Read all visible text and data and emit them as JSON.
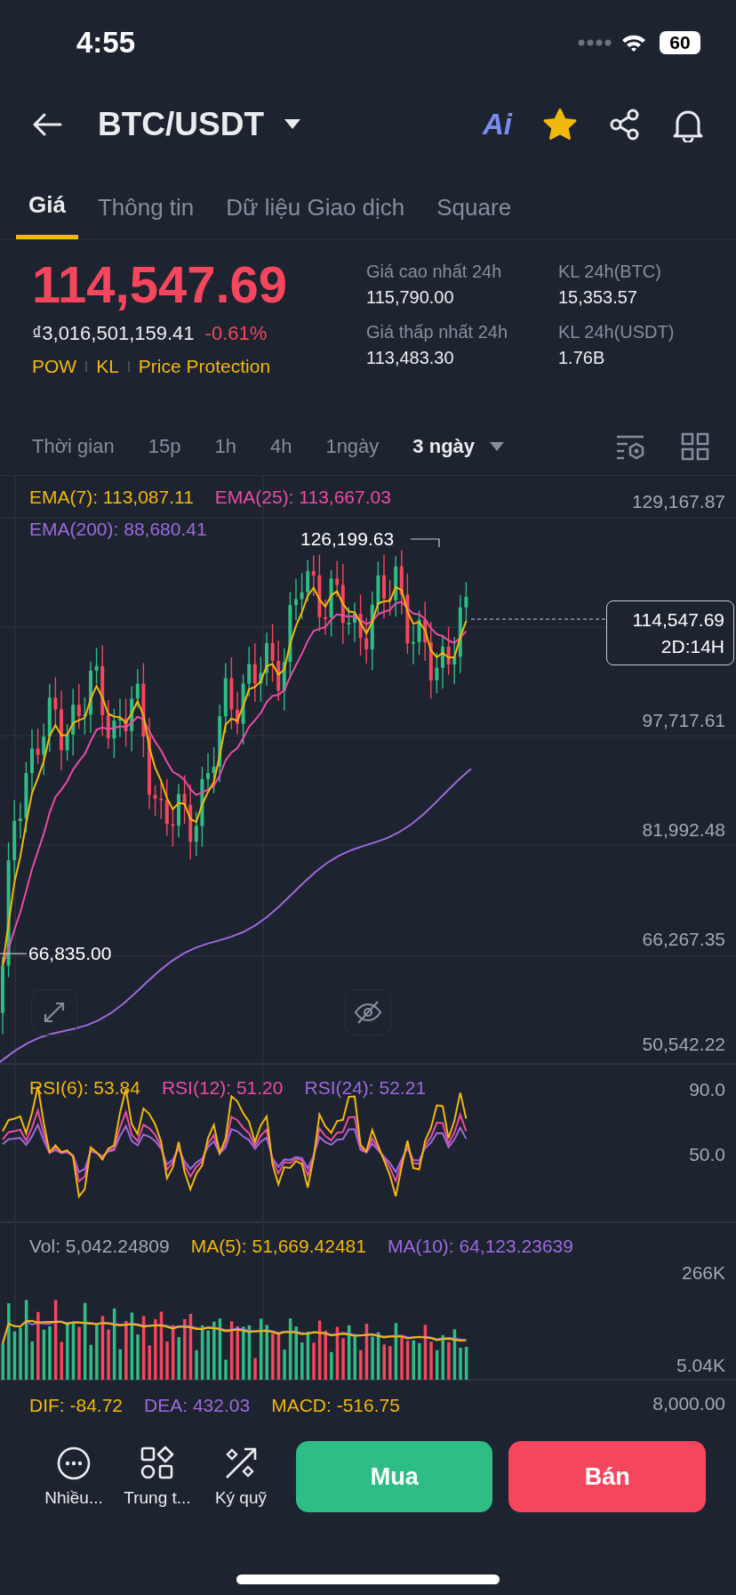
{
  "status_bar": {
    "time": "4:55",
    "battery": "60"
  },
  "header": {
    "pair": "BTC/USDT",
    "ai_label": "Ai",
    "favorite": true
  },
  "tabs": [
    {
      "label": "Giá",
      "selected": true
    },
    {
      "label": "Thông tin",
      "selected": false
    },
    {
      "label": "Dữ liệu Giao dịch",
      "selected": false
    },
    {
      "label": "Square",
      "selected": false
    }
  ],
  "ticker": {
    "price": "114,547.69",
    "fiat_price": "₫3,016,501,159.41",
    "change": "-0.61%",
    "tags": [
      "POW",
      "KL",
      "Price Protection"
    ],
    "stats": [
      {
        "label": "Giá cao nhất 24h",
        "value": "115,790.00"
      },
      {
        "label": "KL 24h(BTC)",
        "value": "15,353.57"
      },
      {
        "label": "Giá thấp nhất 24h",
        "value": "113,483.30"
      },
      {
        "label": "KL 24h(USDT)",
        "value": "1.76B"
      }
    ]
  },
  "intervals": {
    "label": "Thời gian",
    "options": [
      {
        "label": "15p",
        "selected": false
      },
      {
        "label": "1h",
        "selected": false
      },
      {
        "label": "4h",
        "selected": false
      },
      {
        "label": "1ngày",
        "selected": false
      },
      {
        "label": "3 ngày",
        "selected": true
      }
    ]
  },
  "chart": {
    "legend": [
      {
        "text": "EMA(7): 113,087.11",
        "color": "#f0b90b"
      },
      {
        "text": "EMA(25): 113,667.03",
        "color": "#e94ca5"
      },
      {
        "text": "EMA(200): 88,680.41",
        "color": "#9c6ade"
      }
    ],
    "y_labels": [
      "129,167.87",
      "97,717.61",
      "81,992.48",
      "66,267.35",
      "50,542.22"
    ],
    "high_label": "126,199.63",
    "low_label": "66,835.00",
    "price_tag": {
      "price": "114,547.69",
      "countdown": "2D:14H"
    }
  },
  "rsi": {
    "legend": [
      {
        "text": "RSI(6): 53.84",
        "color": "#f0b90b"
      },
      {
        "text": "RSI(12): 51.20",
        "color": "#e94ca5"
      },
      {
        "text": "RSI(24): 52.21",
        "color": "#9c6ade"
      }
    ],
    "y_labels": [
      "90.0",
      "50.0"
    ]
  },
  "volume": {
    "legend": [
      {
        "text": "Vol: 5,042.24809",
        "color": "#a3a9b4"
      },
      {
        "text": "MA(5): 51,669.42481",
        "color": "#f0b90b"
      },
      {
        "text": "MA(10): 64,123.23639",
        "color": "#9c6ade"
      }
    ],
    "y_labels": [
      "266K",
      "5.04K"
    ]
  },
  "macd": {
    "legend": [
      {
        "text": "DIF: -84.72",
        "color": "#f0b90b"
      },
      {
        "text": "DEA: 432.03",
        "color": "#9c6ade"
      },
      {
        "text": "MACD: -516.75",
        "color": "#f0b90b"
      }
    ],
    "y_labels": [
      "8,000.00"
    ]
  },
  "bottom_bar": {
    "actions": [
      {
        "label": "Nhiều...",
        "kind": "more"
      },
      {
        "label": "Trung t...",
        "kind": "hub"
      },
      {
        "label": "Ký quỹ",
        "kind": "margin"
      }
    ],
    "buy": "Mua",
    "sell": "Bán"
  }
}
